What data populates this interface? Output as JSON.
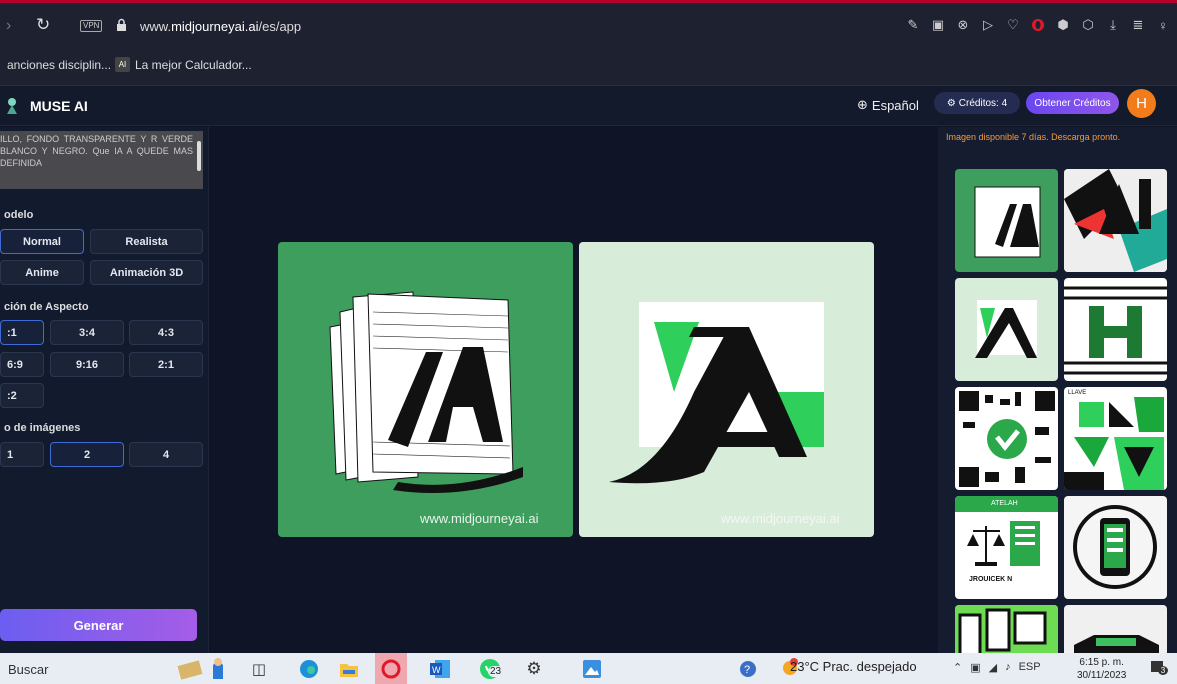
{
  "browser": {
    "url_prefix": "www.",
    "url_domain": "midjourneyai.ai",
    "url_path": "/es/app",
    "vpn_label": "VPN",
    "bookmarks": [
      "anciones disciplin...",
      "La mejor Calculador..."
    ],
    "bookmark_icon_text": "AI"
  },
  "header": {
    "brand": "MUSE AI",
    "language": "Español",
    "credits_label": "Créditos: 4",
    "get_credits": "Obtener Créditos",
    "avatar_letter": "H"
  },
  "sidebar": {
    "prompt_text": "ILLO, FONDO TRANSPARENTE Y R VERDE BLANCO Y NEGRO. Que IA A QUEDE MAS DEFINIDA",
    "model_label": "odelo",
    "models": [
      "Normal",
      "Realista",
      "Anime",
      "Animación 3D"
    ],
    "selected_model": "Normal",
    "aspect_label": "ción de Aspecto",
    "aspects": [
      ":1",
      "3:4",
      "4:3",
      "6:9",
      "9:16",
      "2:1",
      ":2"
    ],
    "selected_aspect": ":1",
    "count_label": "o de imágenes",
    "counts": [
      "1",
      "2",
      "4"
    ],
    "selected_count": "2",
    "generate": "Generar"
  },
  "main": {
    "watermark": "www.midjourneyai.ai"
  },
  "right_panel": {
    "notice": "Imagen disponible 7 días. Descarga pronto.",
    "thumb_labels": [
      "LLAVE",
      "ATELAH",
      "JROUICEK N"
    ]
  },
  "taskbar": {
    "search": "Buscar",
    "whatsapp_badge": "23",
    "weather": "23°C  Prac. despejado",
    "lang": "ESP",
    "time": "6:15 p. m.",
    "date": "30/11/2023",
    "notif_count": "3"
  },
  "colors": {
    "accent": "#6a47f0",
    "avatar": "#f27c1a",
    "notice": "#f59b3a",
    "green": "#3d9e5e"
  }
}
